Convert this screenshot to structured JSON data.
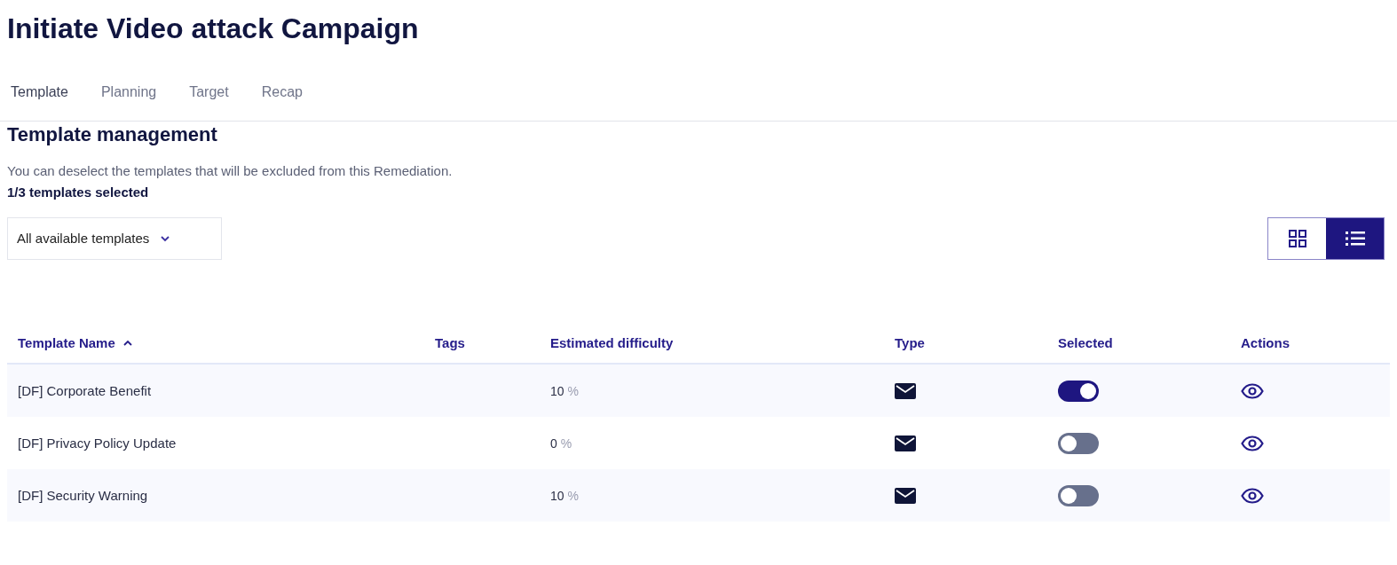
{
  "title": "Initiate Video attack Campaign",
  "tabs": [
    {
      "label": "Template",
      "selected": true
    },
    {
      "label": "Planning",
      "selected": false
    },
    {
      "label": "Target",
      "selected": false
    },
    {
      "label": "Recap",
      "selected": false
    }
  ],
  "section": {
    "heading": "Template management",
    "description": "You can deselect the templates that will be excluded from this Remediation.",
    "count": "1/3 templates selected"
  },
  "filter": {
    "value": "All available templates"
  },
  "view_toggle": [
    {
      "kind": "grid",
      "selected": false
    },
    {
      "kind": "list",
      "selected": true
    }
  ],
  "table": {
    "columns": [
      {
        "label": "Template Name",
        "sorted": true
      },
      {
        "label": "Tags",
        "sorted": false
      },
      {
        "label": "Estimated difficulty",
        "sorted": false
      },
      {
        "label": "Type",
        "sorted": false
      },
      {
        "label": "Selected",
        "sorted": false
      },
      {
        "label": "Actions",
        "sorted": false
      }
    ],
    "rows": [
      {
        "name": "[DF] Corporate Benefit",
        "difficulty": "10",
        "unit": "%",
        "selected": true
      },
      {
        "name": "[DF] Privacy Policy Update",
        "difficulty": "0",
        "unit": "%",
        "selected": false
      },
      {
        "name": "[DF] Security Warning",
        "difficulty": "10",
        "unit": "%",
        "selected": false
      }
    ]
  }
}
